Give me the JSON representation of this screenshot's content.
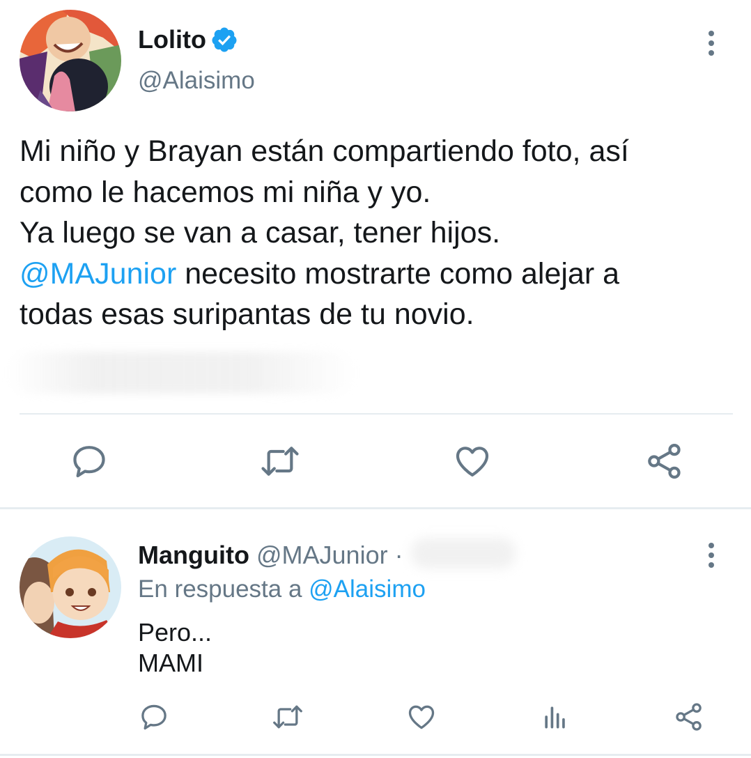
{
  "main_tweet": {
    "author_name": "Lolito",
    "author_handle": "@Alaisimo",
    "verified": true,
    "text_lines": [
      "Mi niño y Brayan están compartiendo foto, así",
      "como le hacemos mi niña y yo.",
      "Ya luego se van a casar, tener hijos."
    ],
    "mention": "@MAJunior",
    "mention_line_rest": " necesito mostrarte como alejar a",
    "last_line": "todas esas suripantas de tu novio.",
    "actions": [
      "reply-icon",
      "retweet-icon",
      "like-icon",
      "share-icon"
    ]
  },
  "reply_tweet": {
    "author_name": "Manguito",
    "author_handle": "@MAJunior",
    "separator": "·",
    "reply_prefix": "En respuesta a ",
    "reply_to": "@Alaisimo",
    "text_lines": [
      "Pero...",
      "MAMI"
    ],
    "actions": [
      "reply-icon",
      "retweet-icon",
      "like-icon",
      "analytics-icon",
      "share-icon"
    ]
  },
  "colors": {
    "accent": "#1da1f2",
    "secondary_text": "#657786",
    "primary_text": "#14171a",
    "divider": "#e6ecf0"
  }
}
